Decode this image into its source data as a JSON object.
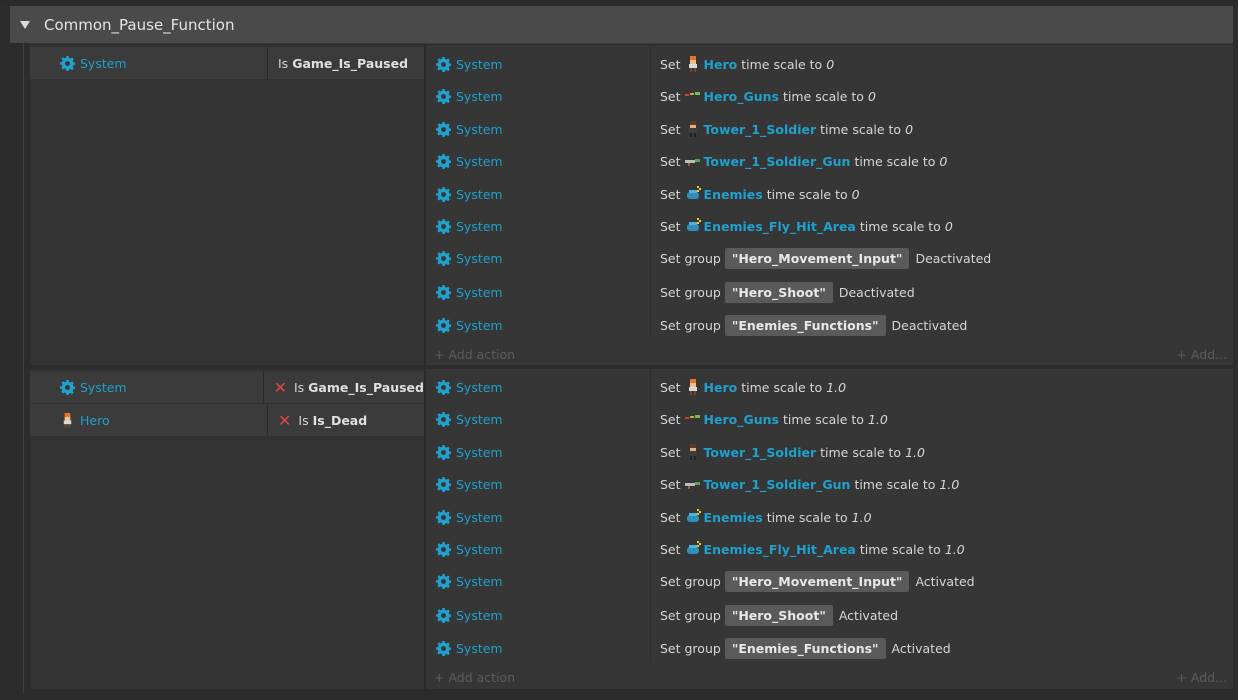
{
  "group": {
    "title": "Common_Pause_Function"
  },
  "add_action_label": "Add action",
  "add_more_label": "Add...",
  "events": [
    {
      "conditions": [
        {
          "object": "System",
          "icon": "gear-icon",
          "negated": false,
          "prefix": "Is",
          "variable": "Game_Is_Paused"
        }
      ],
      "actions": [
        {
          "object": "System",
          "verb": "Set",
          "target": "Hero",
          "target_icon": "hero-sprite-icon",
          "rest": "time scale to",
          "value": "0"
        },
        {
          "object": "System",
          "verb": "Set",
          "target": "Hero_Guns",
          "target_icon": "hero-guns-sprite-icon",
          "rest": "time scale to",
          "value": "0"
        },
        {
          "object": "System",
          "verb": "Set",
          "target": "Tower_1_Soldier",
          "target_icon": "soldier-sprite-icon",
          "rest": "time scale to",
          "value": "0"
        },
        {
          "object": "System",
          "verb": "Set",
          "target": "Tower_1_Soldier_Gun",
          "target_icon": "soldier-gun-sprite-icon",
          "rest": "time scale to",
          "value": "0"
        },
        {
          "object": "System",
          "verb": "Set",
          "target": "Enemies",
          "target_icon": "enemies-family-icon",
          "rest": "time scale to",
          "value": "0"
        },
        {
          "object": "System",
          "verb": "Set",
          "target": "Enemies_Fly_Hit_Area",
          "target_icon": "enemies-family-icon",
          "rest": "time scale to",
          "value": "0"
        },
        {
          "object": "System",
          "verb": "Set group",
          "group": "\"Hero_Movement_Input\"",
          "state": "Deactivated"
        },
        {
          "object": "System",
          "verb": "Set group",
          "group": "\"Hero_Shoot\"",
          "state": "Deactivated"
        },
        {
          "object": "System",
          "verb": "Set group",
          "group": "\"Enemies_Functions\"",
          "state": "Deactivated"
        }
      ]
    },
    {
      "conditions": [
        {
          "object": "System",
          "icon": "gear-icon",
          "negated": true,
          "prefix": "Is",
          "variable": "Game_Is_Paused"
        },
        {
          "object": "Hero",
          "icon": "hero-sprite-icon",
          "negated": true,
          "prefix": "Is",
          "variable": "Is_Dead"
        }
      ],
      "actions": [
        {
          "object": "System",
          "verb": "Set",
          "target": "Hero",
          "target_icon": "hero-sprite-icon",
          "rest": "time scale to",
          "value": "1.0"
        },
        {
          "object": "System",
          "verb": "Set",
          "target": "Hero_Guns",
          "target_icon": "hero-guns-sprite-icon",
          "rest": "time scale to",
          "value": "1.0"
        },
        {
          "object": "System",
          "verb": "Set",
          "target": "Tower_1_Soldier",
          "target_icon": "soldier-sprite-icon",
          "rest": "time scale to",
          "value": "1.0"
        },
        {
          "object": "System",
          "verb": "Set",
          "target": "Tower_1_Soldier_Gun",
          "target_icon": "soldier-gun-sprite-icon",
          "rest": "time scale to",
          "value": "1.0"
        },
        {
          "object": "System",
          "verb": "Set",
          "target": "Enemies",
          "target_icon": "enemies-family-icon",
          "rest": "time scale to",
          "value": "1.0"
        },
        {
          "object": "System",
          "verb": "Set",
          "target": "Enemies_Fly_Hit_Area",
          "target_icon": "enemies-family-icon",
          "rest": "time scale to",
          "value": "1.0"
        },
        {
          "object": "System",
          "verb": "Set group",
          "group": "\"Hero_Movement_Input\"",
          "state": "Activated"
        },
        {
          "object": "System",
          "verb": "Set group",
          "group": "\"Hero_Shoot\"",
          "state": "Activated"
        },
        {
          "object": "System",
          "verb": "Set group",
          "group": "\"Enemies_Functions\"",
          "state": "Activated"
        }
      ]
    }
  ]
}
